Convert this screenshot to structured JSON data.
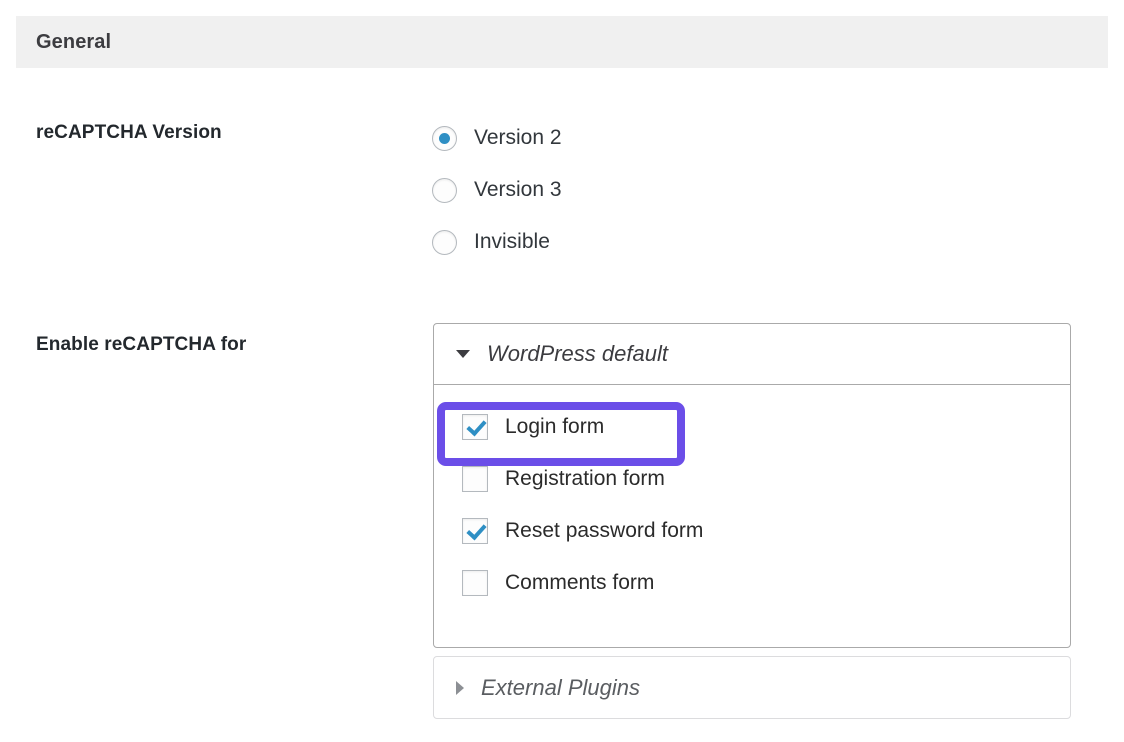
{
  "section": {
    "title": "General"
  },
  "fields": {
    "version": {
      "label": "reCAPTCHA Version",
      "options": [
        {
          "label": "Version 2",
          "selected": true
        },
        {
          "label": "Version 3",
          "selected": false
        },
        {
          "label": "Invisible",
          "selected": false
        }
      ]
    },
    "enable_for": {
      "label": "Enable reCAPTCHA for",
      "panels": [
        {
          "title": "WordPress default",
          "state": "expanded",
          "caret": "caret-down-icon",
          "items": [
            {
              "label": "Login form",
              "checked": true,
              "highlighted": true
            },
            {
              "label": "Registration form",
              "checked": false,
              "highlighted": false
            },
            {
              "label": "Reset password form",
              "checked": true,
              "highlighted": false
            },
            {
              "label": "Comments form",
              "checked": false,
              "highlighted": false
            }
          ]
        },
        {
          "title": "External Plugins",
          "state": "collapsed",
          "caret": "caret-right-icon",
          "items": []
        }
      ]
    }
  },
  "colors": {
    "header_bg": "#f0f0f0",
    "accent_blue": "#2e8fc4",
    "highlight_purple": "#6b4ee8",
    "panel_border": "#aaaaaa",
    "text": "#23282d"
  }
}
